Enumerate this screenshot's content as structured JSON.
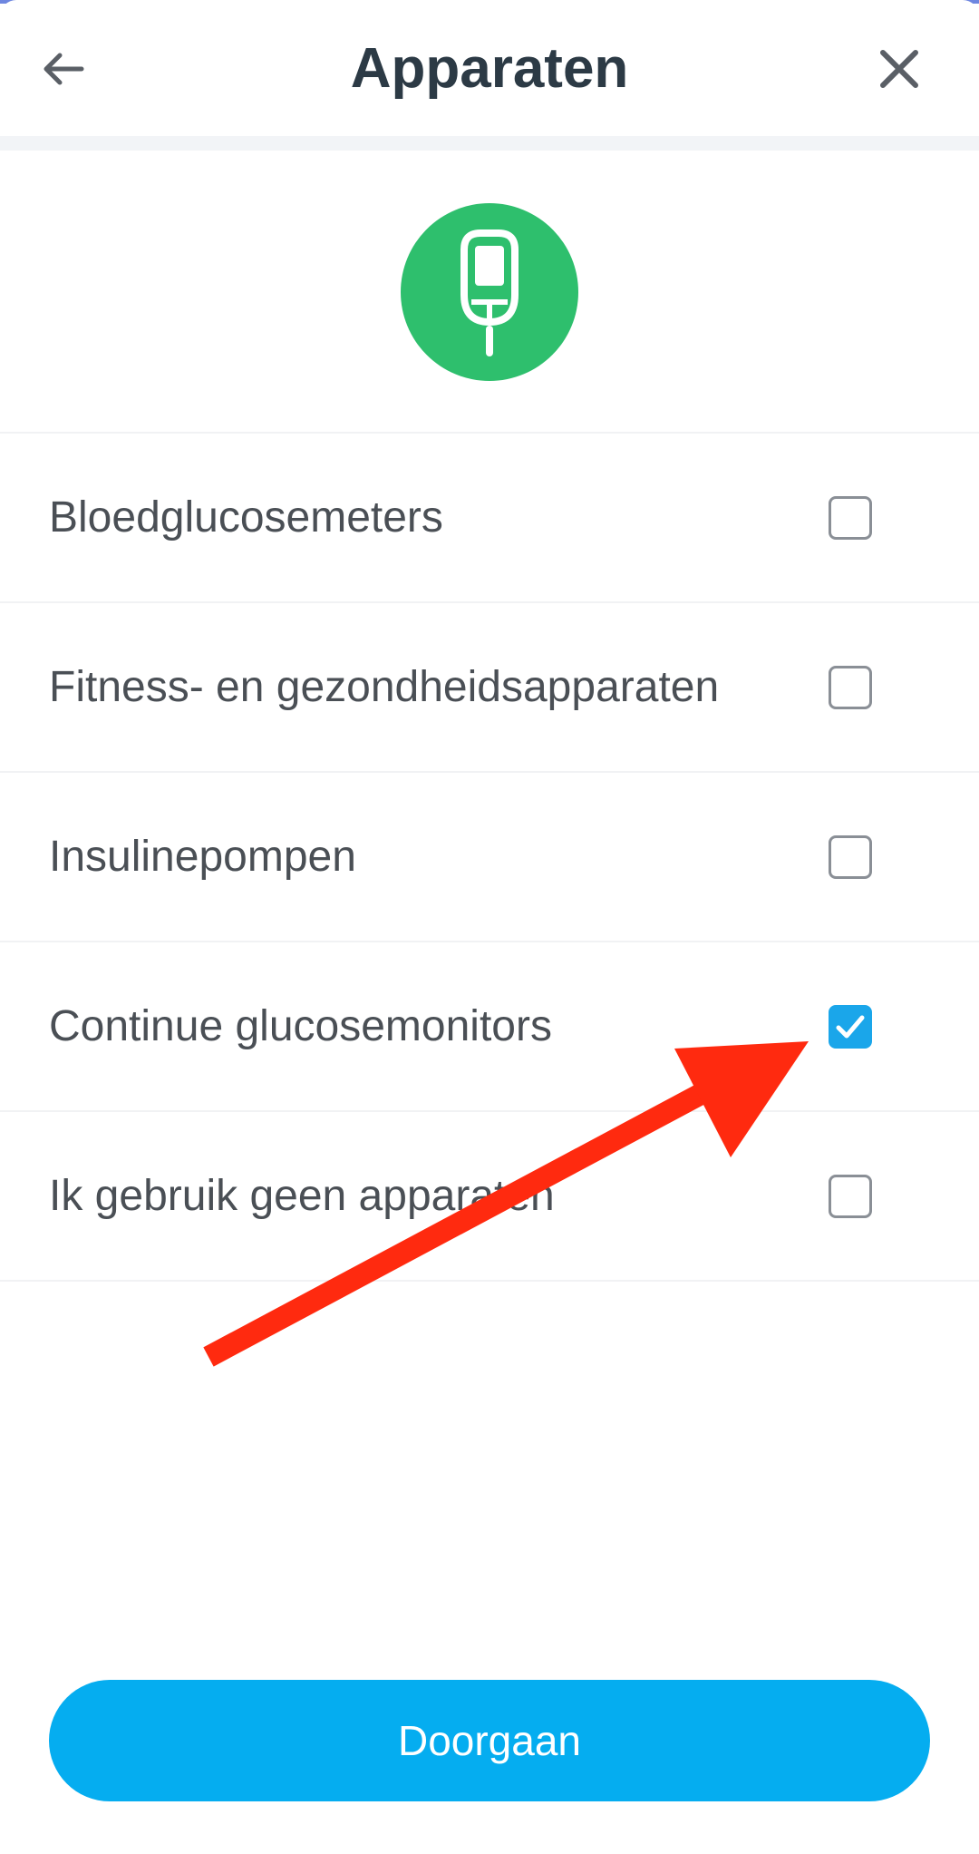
{
  "header": {
    "title": "Apparaten",
    "back_icon": "arrow-left-icon",
    "close_icon": "close-icon"
  },
  "hero_icon": "glucose-meter-icon",
  "options": [
    {
      "label": "Bloedglucosemeters",
      "checked": false
    },
    {
      "label": "Fitness- en gezondheidsapparaten",
      "checked": false
    },
    {
      "label": "Insulinepompen",
      "checked": false
    },
    {
      "label": "Continue glucosemonitors",
      "checked": true
    },
    {
      "label": "Ik gebruik geen apparaten",
      "checked": false
    }
  ],
  "continue_label": "Doorgaan",
  "colors": {
    "accent": "#05adf0",
    "checkbox_checked": "#1aa6ea",
    "hero_circle": "#2ebf6d",
    "annotation_arrow": "#ff2a0f",
    "title_text": "#2c3a45"
  }
}
